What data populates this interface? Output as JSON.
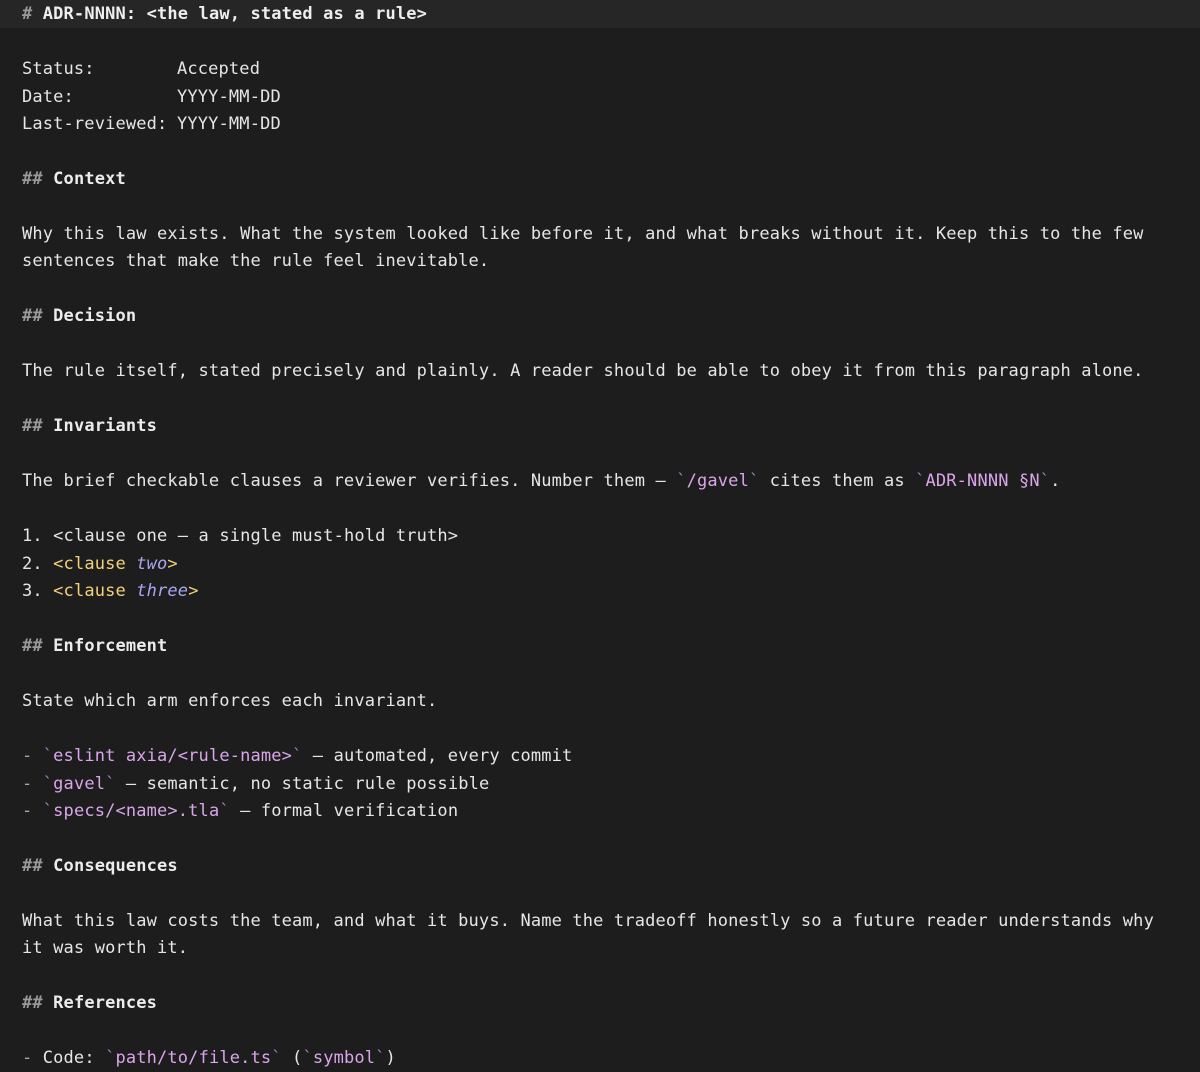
{
  "title": {
    "hash": "#",
    "text": "ADR-NNNN: <the law, stated as a rule>"
  },
  "meta": [
    {
      "label": "Status:",
      "value": "Accepted"
    },
    {
      "label": "Date:",
      "value": "YYYY-MM-DD"
    },
    {
      "label": "Last-reviewed:",
      "value": "YYYY-MM-DD"
    }
  ],
  "heading_hash": "##",
  "context": {
    "heading": "Context",
    "line1": "Why this law exists. What the system looked like before it, and what breaks without it. Keep this to the few",
    "line2": "sentences that make the rule feel inevitable."
  },
  "decision": {
    "heading": "Decision",
    "line1": "The rule itself, stated precisely and plainly. A reader should be able to obey it from this paragraph alone."
  },
  "invariants": {
    "heading": "Invariants",
    "text_a": "The brief checkable clauses a reviewer verifies. Number them — ",
    "code_a": "/gavel",
    "text_b": " cites them as ",
    "code_b": "ADR-NNNN §N",
    "text_c": ".",
    "items": [
      {
        "num": "1.",
        "open": "<clause one — a single must-hold truth>",
        "em": "",
        "close": ""
      },
      {
        "num": "2.",
        "open": "<clause ",
        "em": "two",
        "close": ">"
      },
      {
        "num": "3.",
        "open": "<clause ",
        "em": "three",
        "close": ">"
      }
    ]
  },
  "enforcement": {
    "heading": "Enforcement",
    "intro": "State which arm enforces each invariant.",
    "items": [
      {
        "dash": "-",
        "code": "eslint axia/<rule-name>",
        "text": " — automated, every commit"
      },
      {
        "dash": "-",
        "code": "gavel",
        "text": " — semantic, no static rule possible"
      },
      {
        "dash": "-",
        "code": "specs/<name>.tla",
        "text": " — formal verification"
      }
    ]
  },
  "consequences": {
    "heading": "Consequences",
    "line1": "What this law costs the team, and what it buys. Name the tradeoff honestly so a future reader understands why",
    "line2": "it was worth it."
  },
  "references": {
    "heading": "References",
    "dash": "-",
    "label": "Code: ",
    "code_a": "path/to/file.ts",
    "mid": " (",
    "code_b": "symbol",
    "end": ")"
  },
  "backtick": "`"
}
